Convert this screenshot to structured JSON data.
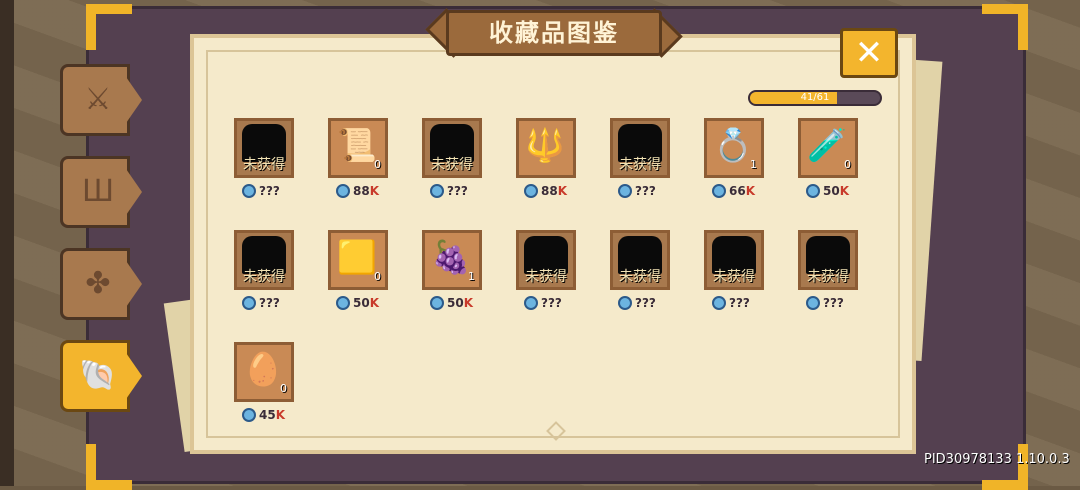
{
  "title": "收藏品图鉴",
  "close_label": "✕",
  "progress": {
    "text": "41/61",
    "fraction": 0.672
  },
  "locked_label": "未获得",
  "tabs": [
    {
      "name": "weapons",
      "icon": "sword-icon",
      "glyph": "⚔",
      "active": false
    },
    {
      "name": "armor",
      "icon": "armor-icon",
      "glyph": "Ш",
      "active": false
    },
    {
      "name": "pets",
      "icon": "clover-icon",
      "glyph": "✤",
      "active": false
    },
    {
      "name": "collections",
      "icon": "shell-icon",
      "glyph": "🐚",
      "active": true
    }
  ],
  "items": [
    {
      "locked": true,
      "price": "???",
      "k": ""
    },
    {
      "locked": false,
      "glyph": "📜",
      "count": "0",
      "price": "88",
      "k": "K"
    },
    {
      "locked": true,
      "price": "???",
      "k": ""
    },
    {
      "locked": false,
      "glyph": "🔱",
      "count": "",
      "price": "88",
      "k": "K"
    },
    {
      "locked": true,
      "price": "???",
      "k": ""
    },
    {
      "locked": false,
      "glyph": "💍",
      "count": "1",
      "price": "66",
      "k": "K"
    },
    {
      "locked": false,
      "glyph": "🧪",
      "count": "0",
      "price": "50",
      "k": "K"
    },
    {
      "locked": true,
      "price": "???",
      "k": ""
    },
    {
      "locked": false,
      "glyph": "🟨",
      "count": "0",
      "price": "50",
      "k": "K"
    },
    {
      "locked": false,
      "glyph": "🍇",
      "count": "1",
      "price": "50",
      "k": "K"
    },
    {
      "locked": true,
      "price": "???",
      "k": ""
    },
    {
      "locked": true,
      "price": "???",
      "k": ""
    },
    {
      "locked": true,
      "price": "???",
      "k": ""
    },
    {
      "locked": true,
      "price": "???",
      "k": ""
    },
    {
      "locked": false,
      "glyph": "🥚",
      "count": "0",
      "price": "45",
      "k": "K"
    }
  ],
  "pid": "PID30978133 1.10.0.3"
}
